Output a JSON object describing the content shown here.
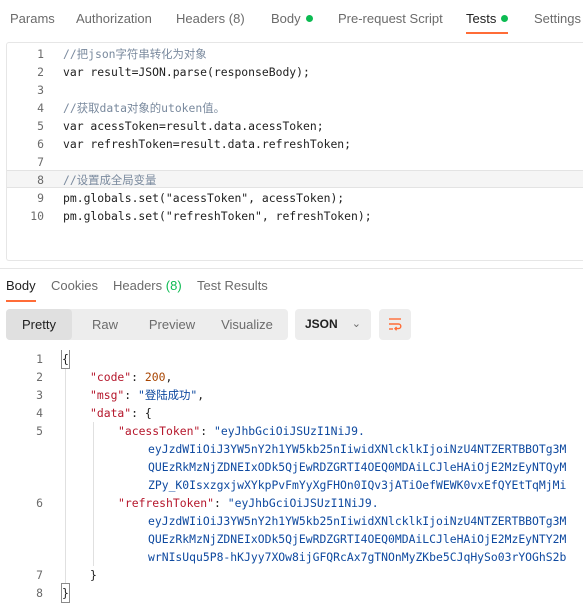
{
  "request_tabs": [
    {
      "label": "Params"
    },
    {
      "label": "Authorization"
    },
    {
      "label": "Headers",
      "count": "(8)"
    },
    {
      "label": "Body"
    },
    {
      "label": "Pre-request Script"
    },
    {
      "label": "Tests"
    },
    {
      "label": "Settings"
    }
  ],
  "editor": {
    "line_numbers": [
      "1",
      "2",
      "3",
      "4",
      "5",
      "6",
      "7",
      "8",
      "9",
      "10"
    ],
    "lines": [
      "//把json字符串转化为对象",
      "var result=JSON.parse(responseBody);",
      "",
      "//获取data对象的utoken值。",
      "var acessToken=result.data.acessToken;",
      "var refreshToken=result.data.refreshToken;",
      "",
      "//设置成全局变量",
      "pm.globals.set(\"acessToken\", acessToken);",
      "pm.globals.set(\"refreshToken\", refreshToken);"
    ]
  },
  "response_tabs": [
    {
      "label": "Body"
    },
    {
      "label": "Cookies"
    },
    {
      "label": "Headers",
      "count": "(8)"
    },
    {
      "label": "Test Results"
    }
  ],
  "view_modes": [
    "Pretty",
    "Raw",
    "Preview",
    "Visualize"
  ],
  "format_select": "JSON",
  "response": {
    "line_numbers": [
      "1",
      "2",
      "3",
      "4",
      "5",
      "",
      "",
      "",
      "6",
      "",
      "",
      "",
      "7",
      "8"
    ],
    "open_brace": "{",
    "close_brace": "}",
    "code_key": "\"code\"",
    "code_value": "200",
    "msg_key": "\"msg\"",
    "msg_value": "\"登陆成功\"",
    "data_key": "\"data\"",
    "data_open": "{",
    "data_close": "}",
    "acess_key": "\"acessToken\"",
    "acess_value": [
      "\"eyJhbGciOiJSUzI1NiJ9.",
      "eyJzdWIiOiJ3YW5nY2h1YW5kb25nIiwidXNlcklkIjoiNzU4NTZERTBBOTg3M",
      "QUEzRkMzNjZDNEIxODk5QjEwRDZGRTI4OEQ0MDAiLCJleHAiOjE2MzEyNTQyM",
      "ZPy_K0IsxzgxjwXYkpPvFmYyXgFHOn0IQv3jATiOefWEWK0vxEfQYEtTqMjMi"
    ],
    "refresh_key": "\"refreshToken\"",
    "refresh_value": [
      "\"eyJhbGciOiJSUzI1NiJ9.",
      "eyJzdWIiOiJ3YW5nY2h1YW5kb25nIiwidXNlcklkIjoiNzU4NTZERTBBOTg3M",
      "QUEzRkMzNjZDNEIxODk5QjEwRDZGRTI4OEQ0MDAiLCJleHAiOjE2MzEyNTY2M",
      "wrNIsUqu5P8-hKJyy7XOw8ijGFQRcAx7gTNOnMyZKbe5CJqHySo03rYOGhS2b"
    ]
  },
  "colors": {
    "accent": "#ff6c37",
    "status_dot": "#0cbb52"
  }
}
